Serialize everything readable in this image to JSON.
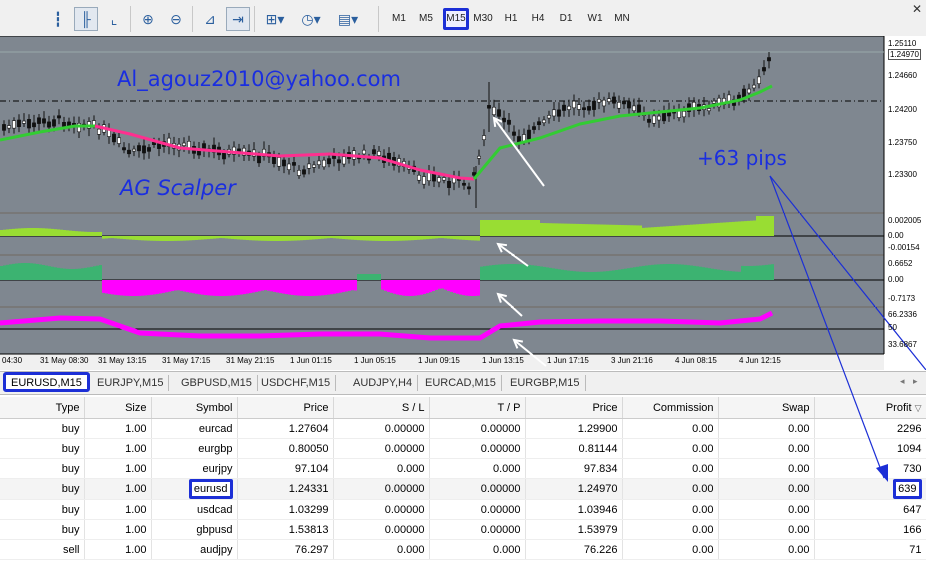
{
  "toolbar": {
    "timeframes": [
      "M1",
      "M5",
      "M15",
      "M30",
      "H1",
      "H4",
      "D1",
      "W1",
      "MN"
    ],
    "selected_timeframe": "M15",
    "tools": [
      "bar-chart-icon",
      "candlestick-icon",
      "line-chart-icon",
      "zoom-in-icon",
      "zoom-out-icon",
      "autoscroll-icon",
      "chart-shift-icon",
      "indicators-icon",
      "periodicity-icon",
      "templates-icon"
    ]
  },
  "chart": {
    "watermark_email": "Al_agouz2010@yahoo.com",
    "watermark_title": "AG Scalper",
    "annotation": "+63 pips",
    "price_labels": [
      "1.25110",
      "1.24970",
      "1.24660",
      "1.24200",
      "1.23750",
      "1.23300"
    ],
    "current_price": "1.24970",
    "indicator1_labels": [
      "0.002005",
      "0.00",
      "-0.00154"
    ],
    "indicator2_labels": [
      "0.6652",
      "0.00",
      "-0.7173"
    ],
    "indicator3_labels": [
      "66.2336",
      "50",
      "33.6867"
    ],
    "time_labels": [
      "04:30",
      "31 May 08:30",
      "31 May 13:15",
      "31 May 17:15",
      "31 May 21:15",
      "1 Jun 01:15",
      "1 Jun 05:15",
      "1 Jun 09:15",
      "1 Jun 13:15",
      "1 Jun 17:15",
      "3 Jun 21:16",
      "4 Jun 08:15",
      "4 Jun 12:15"
    ],
    "colors": {
      "bg": "#7f8790",
      "up_ma": "#33cc33",
      "down_ma": "#ff2f8f",
      "hist_green": "#99dd33",
      "hist_sea": "#3cb371",
      "magenta": "#ff00ff",
      "accent": "#1c2fd6"
    }
  },
  "tabs": {
    "items": [
      "EURUSD,M15",
      "EURJPY,M15",
      "GBPUSD,M15",
      "USDCHF,M15",
      "AUDJPY,H4",
      "EURCAD,M15",
      "EURGBP,M15"
    ],
    "selected": "EURUSD,M15"
  },
  "table": {
    "columns": [
      "Type",
      "Size",
      "Symbol",
      "Price",
      "S / L",
      "T / P",
      "Price",
      "Commission",
      "Swap",
      "Profit"
    ],
    "rows": [
      {
        "type": "buy",
        "size": "1.00",
        "symbol": "eurcad",
        "open": "1.27604",
        "sl": "0.00000",
        "tp": "0.00000",
        "price": "1.29900",
        "commission": "0.00",
        "swap": "0.00",
        "profit": "2296"
      },
      {
        "type": "buy",
        "size": "1.00",
        "symbol": "eurgbp",
        "open": "0.80050",
        "sl": "0.00000",
        "tp": "0.00000",
        "price": "0.81144",
        "commission": "0.00",
        "swap": "0.00",
        "profit": "1094"
      },
      {
        "type": "buy",
        "size": "1.00",
        "symbol": "eurjpy",
        "open": "97.104",
        "sl": "0.000",
        "tp": "0.000",
        "price": "97.834",
        "commission": "0.00",
        "swap": "0.00",
        "profit": "730"
      },
      {
        "type": "buy",
        "size": "1.00",
        "symbol": "eurusd",
        "open": "1.24331",
        "sl": "0.00000",
        "tp": "0.00000",
        "price": "1.24970",
        "commission": "0.00",
        "swap": "0.00",
        "profit": "639"
      },
      {
        "type": "buy",
        "size": "1.00",
        "symbol": "usdcad",
        "open": "1.03299",
        "sl": "0.00000",
        "tp": "0.00000",
        "price": "1.03946",
        "commission": "0.00",
        "swap": "0.00",
        "profit": "647"
      },
      {
        "type": "buy",
        "size": "1.00",
        "symbol": "gbpusd",
        "open": "1.53813",
        "sl": "0.00000",
        "tp": "0.00000",
        "price": "1.53979",
        "commission": "0.00",
        "swap": "0.00",
        "profit": "166"
      },
      {
        "type": "sell",
        "size": "1.00",
        "symbol": "audjpy",
        "open": "76.297",
        "sl": "0.000",
        "tp": "0.000",
        "price": "76.226",
        "commission": "0.00",
        "swap": "0.00",
        "profit": "71"
      }
    ]
  }
}
